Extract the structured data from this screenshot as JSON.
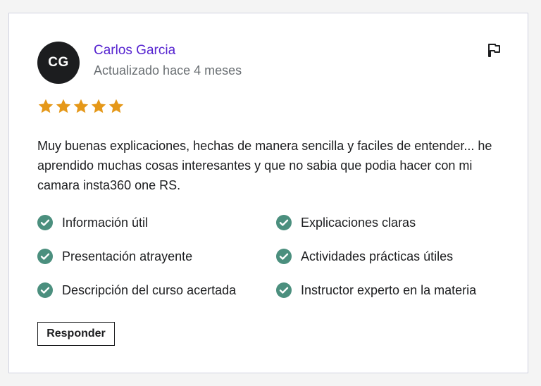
{
  "review": {
    "avatar_initials": "CG",
    "author": "Carlos Garcia",
    "updated": "Actualizado hace 4 meses",
    "rating": 5,
    "rating_max": 5,
    "text": "Muy buenas explicaciones, hechas de manera sencilla y faciles de entender... he aprendido muchas cosas interesantes y que no sabia que podia hacer con mi camara insta360 one RS.",
    "features": [
      "Información útil",
      "Explicaciones claras",
      "Presentación atrayente",
      "Actividades prácticas útiles",
      "Descripción del curso acertada",
      "Instructor experto en la materia"
    ],
    "reply_label": "Responder",
    "icons": {
      "report": "flag-icon",
      "star": "star-icon",
      "feature": "check-circle-icon"
    }
  },
  "colors": {
    "author": "#5624d0",
    "star": "#e59819",
    "check": "#4b8f7e",
    "avatar": "#1c1d1f"
  }
}
